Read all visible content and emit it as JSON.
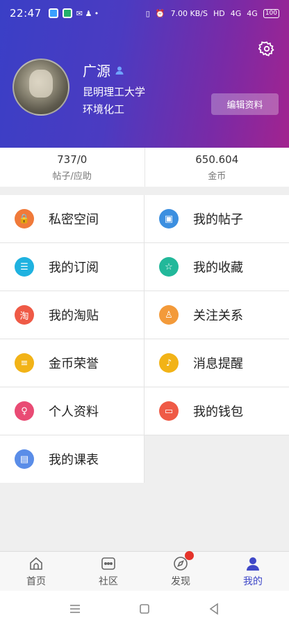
{
  "status_bar": {
    "time": "22:47",
    "net_speed": "7.00 KB/S",
    "network": "HD",
    "signal1": "4G",
    "signal2": "4G",
    "battery": "100"
  },
  "profile": {
    "name": "广源",
    "school": "昆明理工大学",
    "major": "环境化工",
    "edit_label": "编辑资料"
  },
  "stats": [
    {
      "value": "737/0",
      "label": "帖子/应助"
    },
    {
      "value": "650.604",
      "label": "金币"
    }
  ],
  "menu": [
    {
      "label": "私密空间",
      "icon": "lock-icon",
      "color": "#f07a3a",
      "glyph": "🔒"
    },
    {
      "label": "我的帖子",
      "icon": "posts-icon",
      "color": "#3c8fe0",
      "glyph": "▣"
    },
    {
      "label": "我的订阅",
      "icon": "subscribe-icon",
      "color": "#1fb2e0",
      "glyph": "☰"
    },
    {
      "label": "我的收藏",
      "icon": "star-icon",
      "color": "#22b89a",
      "glyph": "☆"
    },
    {
      "label": "我的淘贴",
      "icon": "tao-icon",
      "color": "#ef5a46",
      "glyph": "淘"
    },
    {
      "label": "关注关系",
      "icon": "follow-icon",
      "color": "#f39a3a",
      "glyph": "♙"
    },
    {
      "label": "金币荣誉",
      "icon": "coins-icon",
      "color": "#f2b317",
      "glyph": "≡"
    },
    {
      "label": "消息提醒",
      "icon": "bell-icon",
      "color": "#f2b317",
      "glyph": "♪"
    },
    {
      "label": "个人资料",
      "icon": "profile-icon",
      "color": "#e94b74",
      "glyph": "♀"
    },
    {
      "label": "我的钱包",
      "icon": "wallet-icon",
      "color": "#ef5a46",
      "glyph": "▭"
    },
    {
      "label": "我的课表",
      "icon": "schedule-icon",
      "color": "#5a8de8",
      "glyph": "▤"
    }
  ],
  "tabs": [
    {
      "label": "首页",
      "icon": "home-icon"
    },
    {
      "label": "社区",
      "icon": "community-icon"
    },
    {
      "label": "发现",
      "icon": "compass-icon"
    },
    {
      "label": "我的",
      "icon": "me-icon"
    }
  ],
  "active_tab": "我的",
  "accent_color": "#3f48c8"
}
